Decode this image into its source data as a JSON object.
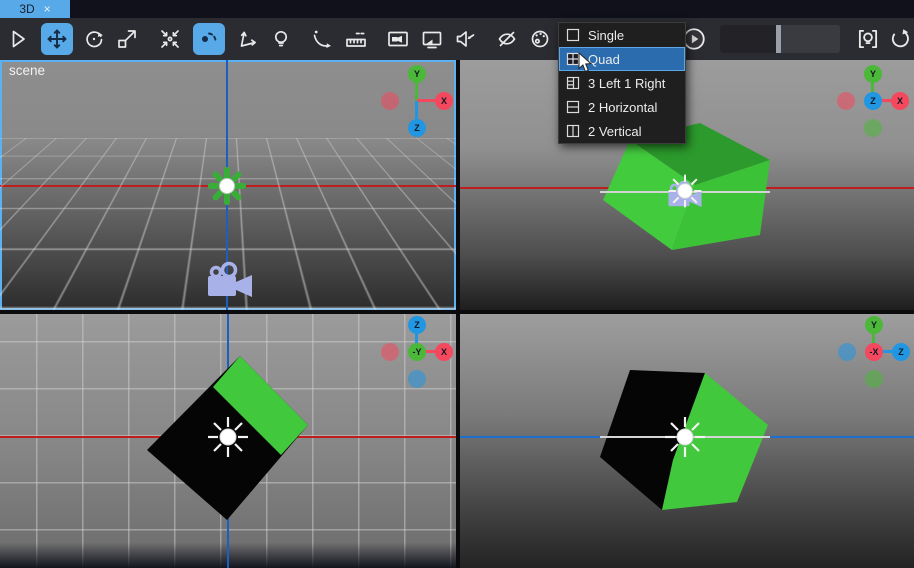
{
  "tab_bar": {
    "tabs": [
      {
        "label": "3D",
        "close": "×",
        "active": true
      }
    ]
  },
  "toolbar": {
    "tools": [
      {
        "id": "select",
        "icon": "select-arrow-icon",
        "active": false
      },
      {
        "id": "move",
        "icon": "move-arrows-icon",
        "active": true
      },
      {
        "id": "rotate",
        "icon": "rotate-circle-icon",
        "active": false
      },
      {
        "id": "scale",
        "icon": "scale-square-icon",
        "active": false
      },
      {
        "id": "frame-selection",
        "icon": "focus-center-icon",
        "active": false
      },
      {
        "id": "pivot",
        "icon": "pivot-point-icon",
        "active": true
      },
      {
        "id": "transform-axes",
        "icon": "axes-arrows-icon",
        "active": false
      },
      {
        "id": "light",
        "icon": "bulb-icon",
        "active": false
      },
      {
        "id": "orbit",
        "icon": "orbit-arc-icon",
        "active": false
      },
      {
        "id": "measure",
        "icon": "ruler-icon",
        "active": false
      },
      {
        "id": "camera-view",
        "icon": "camera-frame-icon",
        "active": false
      },
      {
        "id": "screen-view",
        "icon": "screen-camera-icon",
        "active": false
      },
      {
        "id": "audio",
        "icon": "speaker-icon",
        "active": false
      },
      {
        "id": "visibility-off",
        "icon": "eye-off-icon",
        "active": false
      },
      {
        "id": "palette",
        "icon": "palette-icon",
        "active": false
      },
      {
        "id": "circular-arrow",
        "icon": "circular-arrow-icon",
        "active": false,
        "note": "partially hidden behind menu"
      }
    ],
    "slider": {
      "value_percent": 47
    },
    "right_tools": [
      {
        "id": "viewport-light",
        "icon": "bulb-brackets-icon"
      },
      {
        "id": "reset-view",
        "icon": "refresh-icon"
      }
    ]
  },
  "view_layout_menu": {
    "items": [
      {
        "label": "Single",
        "icon": "layout-single-icon",
        "selected": false
      },
      {
        "label": "Quad",
        "icon": "layout-quad-icon",
        "selected": true
      },
      {
        "label": "3 Left 1 Right",
        "icon": "layout-3left-1right-icon",
        "selected": false
      },
      {
        "label": "2 Horizontal",
        "icon": "layout-2horizontal-icon",
        "selected": false
      },
      {
        "label": "2 Vertical",
        "icon": "layout-2vertical-icon",
        "selected": false
      }
    ]
  },
  "viewports": {
    "top_left": {
      "label": "scene",
      "selected": true,
      "axis_gizmo": {
        "up": "Y",
        "right": "X",
        "down": "Z"
      }
    },
    "top_right": {
      "axis_gizmo": {
        "up": "Y",
        "right": "X",
        "center": "Z"
      }
    },
    "bottom_left": {
      "axis_gizmo": {
        "up": "Z",
        "right": "X",
        "center": "-Y"
      }
    },
    "bottom_right": {
      "axis_gizmo": {
        "up": "Y",
        "right": "Z",
        "center": "-X"
      }
    }
  },
  "scene_objects": {
    "cube": "green cube",
    "light": "point light",
    "camera": "scene camera"
  },
  "colors": {
    "accent": "#57a9e8",
    "selection_border": "#5cb1f2",
    "menu_selected": "#2b6cae",
    "axis_x": "#f4485f",
    "axis_y": "#4cb83a",
    "axis_z": "#2196e3",
    "axis_line_red": "#bf1e1e",
    "axis_line_blue": "#1d5fc0",
    "cube_green": "#42c83c",
    "cube_green_dark": "#2c9a2c",
    "cube_black": "#050505",
    "camera_lavender": "#a9b2e8"
  }
}
